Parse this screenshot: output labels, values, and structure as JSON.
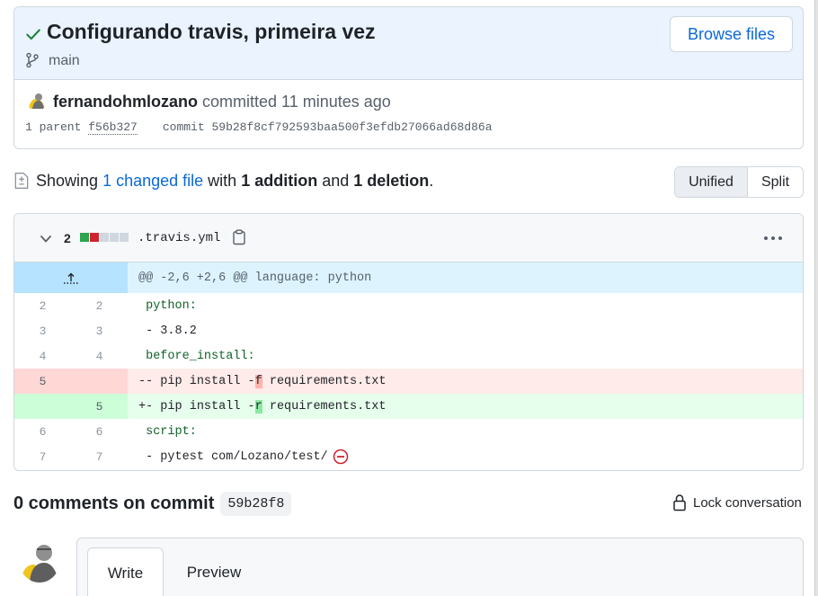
{
  "commit": {
    "title": "Configurando travis, primeira vez",
    "branch": "main",
    "browse_label": "Browse files",
    "author": "fernandohmlozano",
    "action": " committed 11 minutes ago",
    "parent_label": "1 parent",
    "parent_sha": "f56b327",
    "commit_label": "commit",
    "commit_sha": "59b28f8cf792593baa500f3efdb27066ad68d86a"
  },
  "summary": {
    "showing": "Showing ",
    "changed_files": "1 changed file",
    "with": " with ",
    "additions": "1 addition",
    "and": " and ",
    "deletions": "1 deletion",
    "period": ".",
    "view_unified": "Unified",
    "view_split": "Split"
  },
  "file": {
    "change_count": "2",
    "name": ".travis.yml",
    "hunk_header": "@@ -2,6 +2,6 @@ language: python",
    "lines": [
      {
        "old": "2",
        "new": "2",
        "type": "ctx",
        "prefix": " ",
        "text": "python:"
      },
      {
        "old": "3",
        "new": "3",
        "type": "ctx",
        "prefix": " ",
        "text": "- 3.8.2"
      },
      {
        "old": "4",
        "new": "4",
        "type": "ctx",
        "prefix": " ",
        "text": "before_install:"
      },
      {
        "old": "5",
        "new": "",
        "type": "del",
        "prefix": "-",
        "before": "- pip install -",
        "hl": "f",
        "after": " requirements.txt"
      },
      {
        "old": "",
        "new": "5",
        "type": "add",
        "prefix": "+",
        "before": "- pip install -",
        "hl": "r",
        "after": " requirements.txt"
      },
      {
        "old": "6",
        "new": "6",
        "type": "ctx",
        "prefix": " ",
        "text": "script:"
      },
      {
        "old": "7",
        "new": "7",
        "type": "ctx",
        "prefix": " ",
        "text": "- pytest com/Lozano/test/"
      }
    ]
  },
  "comments": {
    "count_label": "0 comments on commit",
    "sha": "59b28f8",
    "lock_label": "Lock conversation",
    "tab_write": "Write",
    "tab_preview": "Preview"
  },
  "colors": {
    "accent": "#0969da",
    "success": "#1a7f37",
    "danger": "#cf222e",
    "header_bg": "#eaf3fe"
  },
  "icons": [
    "check-icon",
    "git-branch-icon",
    "file-diff-icon",
    "chevron-down-icon",
    "copy-icon",
    "kebab-horizontal-icon",
    "expand-up-icon",
    "no-newline-icon",
    "lock-icon"
  ]
}
